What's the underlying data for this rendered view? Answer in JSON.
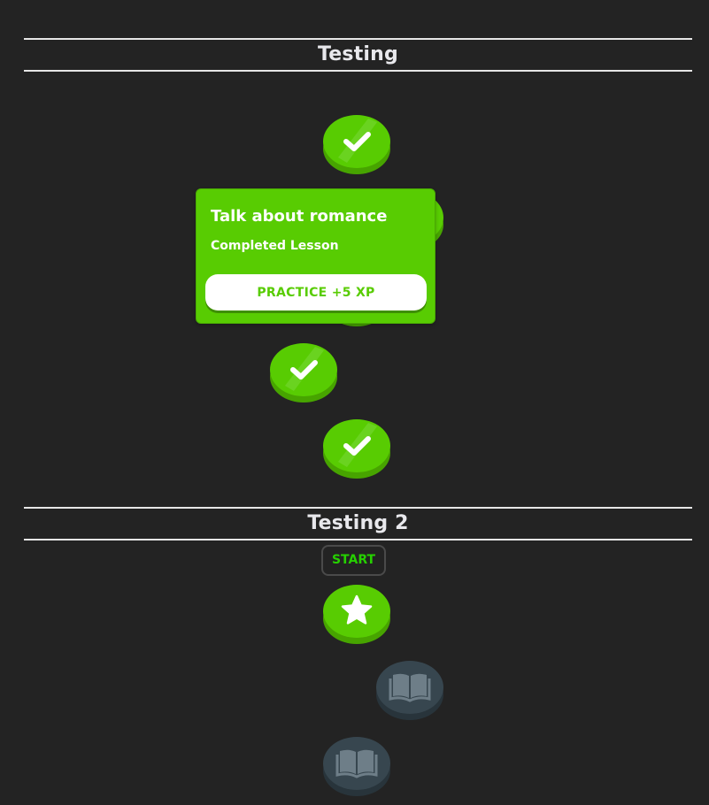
{
  "units": [
    {
      "title": "Testing",
      "lessons": [
        {
          "status": "completed",
          "icon": "check-icon"
        },
        {
          "status": "completed",
          "icon": "check-icon"
        },
        {
          "status": "completed",
          "icon": "check-icon"
        },
        {
          "status": "completed",
          "icon": "check-icon"
        },
        {
          "status": "completed",
          "icon": "check-icon"
        }
      ]
    },
    {
      "title": "Testing 2",
      "start_label": "START",
      "lessons": [
        {
          "status": "current",
          "icon": "star-icon"
        },
        {
          "status": "locked",
          "icon": "book-icon"
        },
        {
          "status": "locked",
          "icon": "book-icon"
        }
      ]
    }
  ],
  "tooltip": {
    "title": "Talk about romance",
    "subtitle": "Completed Lesson",
    "button_label": "PRACTICE +5 XP"
  },
  "colors": {
    "background": "#232323",
    "green": "#58cc02",
    "green_dark": "#4aa400",
    "locked": "#37464f",
    "locked_dark": "#2a353c",
    "start_text": "#26d000"
  }
}
